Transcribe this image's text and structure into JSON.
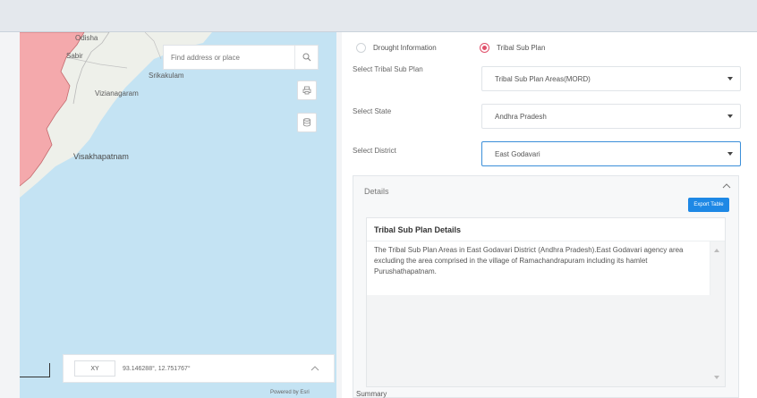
{
  "map": {
    "search_placeholder": "Find address or place",
    "labels": {
      "odisha": "Odisha",
      "sabi": "Sabir",
      "srikakulam": "Srikakulam",
      "vizianagaram": "Vizianagaram",
      "visakhapatnam": "Visakhapatnam"
    },
    "coord_mode": "XY",
    "coord_value": "93.146288°, 12.751767°",
    "attribution": "Powered by Esri",
    "colors": {
      "sea": "#c4e3f3",
      "land": "#f4a9ac",
      "land_light": "#eef0ea"
    }
  },
  "panel": {
    "radio_drought": "Drought Information",
    "radio_tribal": "Tribal Sub Plan",
    "label_tribal_plan": "Select Tribal Sub Plan",
    "value_tribal_plan": "Tribal Sub Plan Areas(MORD)",
    "label_state": "Select State",
    "value_state": "Andhra Pradesh",
    "label_district": "Select District",
    "value_district": "East Godavari",
    "details_title": "Details",
    "export_label": "Export Table",
    "inner_title": "Tribal Sub Plan Details",
    "inner_text": "The Tribal Sub Plan Areas in East Godavari District (Andhra Pradesh).East Godavari agency area excluding the area comprised in the village of Ramachandrapuram including its hamlet Purushathapatnam.",
    "summary_label": "Summary",
    "accent": "#e0506a",
    "primary": "#1e88e5"
  }
}
